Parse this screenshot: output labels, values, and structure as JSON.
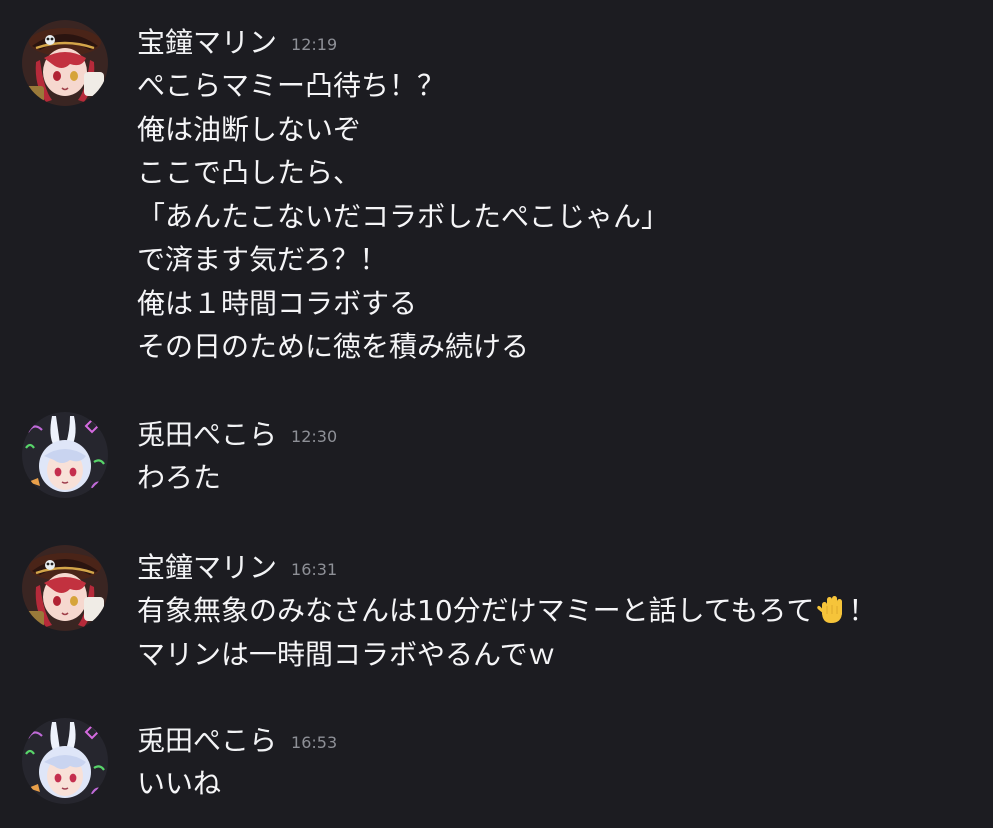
{
  "messages": [
    {
      "author": "宝鐘マリン",
      "time": "12:19",
      "avatar_icon": "marine-avatar-icon",
      "lines": [
        "ぺこらマミー凸待ち！？",
        "俺は油断しないぞ",
        "ここで凸したら、",
        "「あんたこないだコラボしたぺこじゃん」",
        "で済ます気だろ？！",
        "俺は１時間コラボする",
        "その日のために徳を積み続ける"
      ]
    },
    {
      "author": "兎田ぺこら",
      "time": "12:30",
      "avatar_icon": "pekora-avatar-icon",
      "lines": [
        "わろた"
      ]
    },
    {
      "author": "宝鐘マリン",
      "time": "16:31",
      "avatar_icon": "marine-avatar-icon",
      "lines": [
        "有象無象のみなさんは10分だけマミーと話してもろて",
        "マリンは一時間コラボやるんでｗ"
      ],
      "line0_suffix": "！",
      "emoji": "raised-hand-icon"
    },
    {
      "author": "兎田ぺこら",
      "time": "16:53",
      "avatar_icon": "pekora-avatar-icon",
      "lines": [
        "いいね"
      ]
    }
  ],
  "colors": {
    "background": "#1c1c21",
    "text": "#f2f3f5",
    "timestamp": "#8e9097"
  }
}
